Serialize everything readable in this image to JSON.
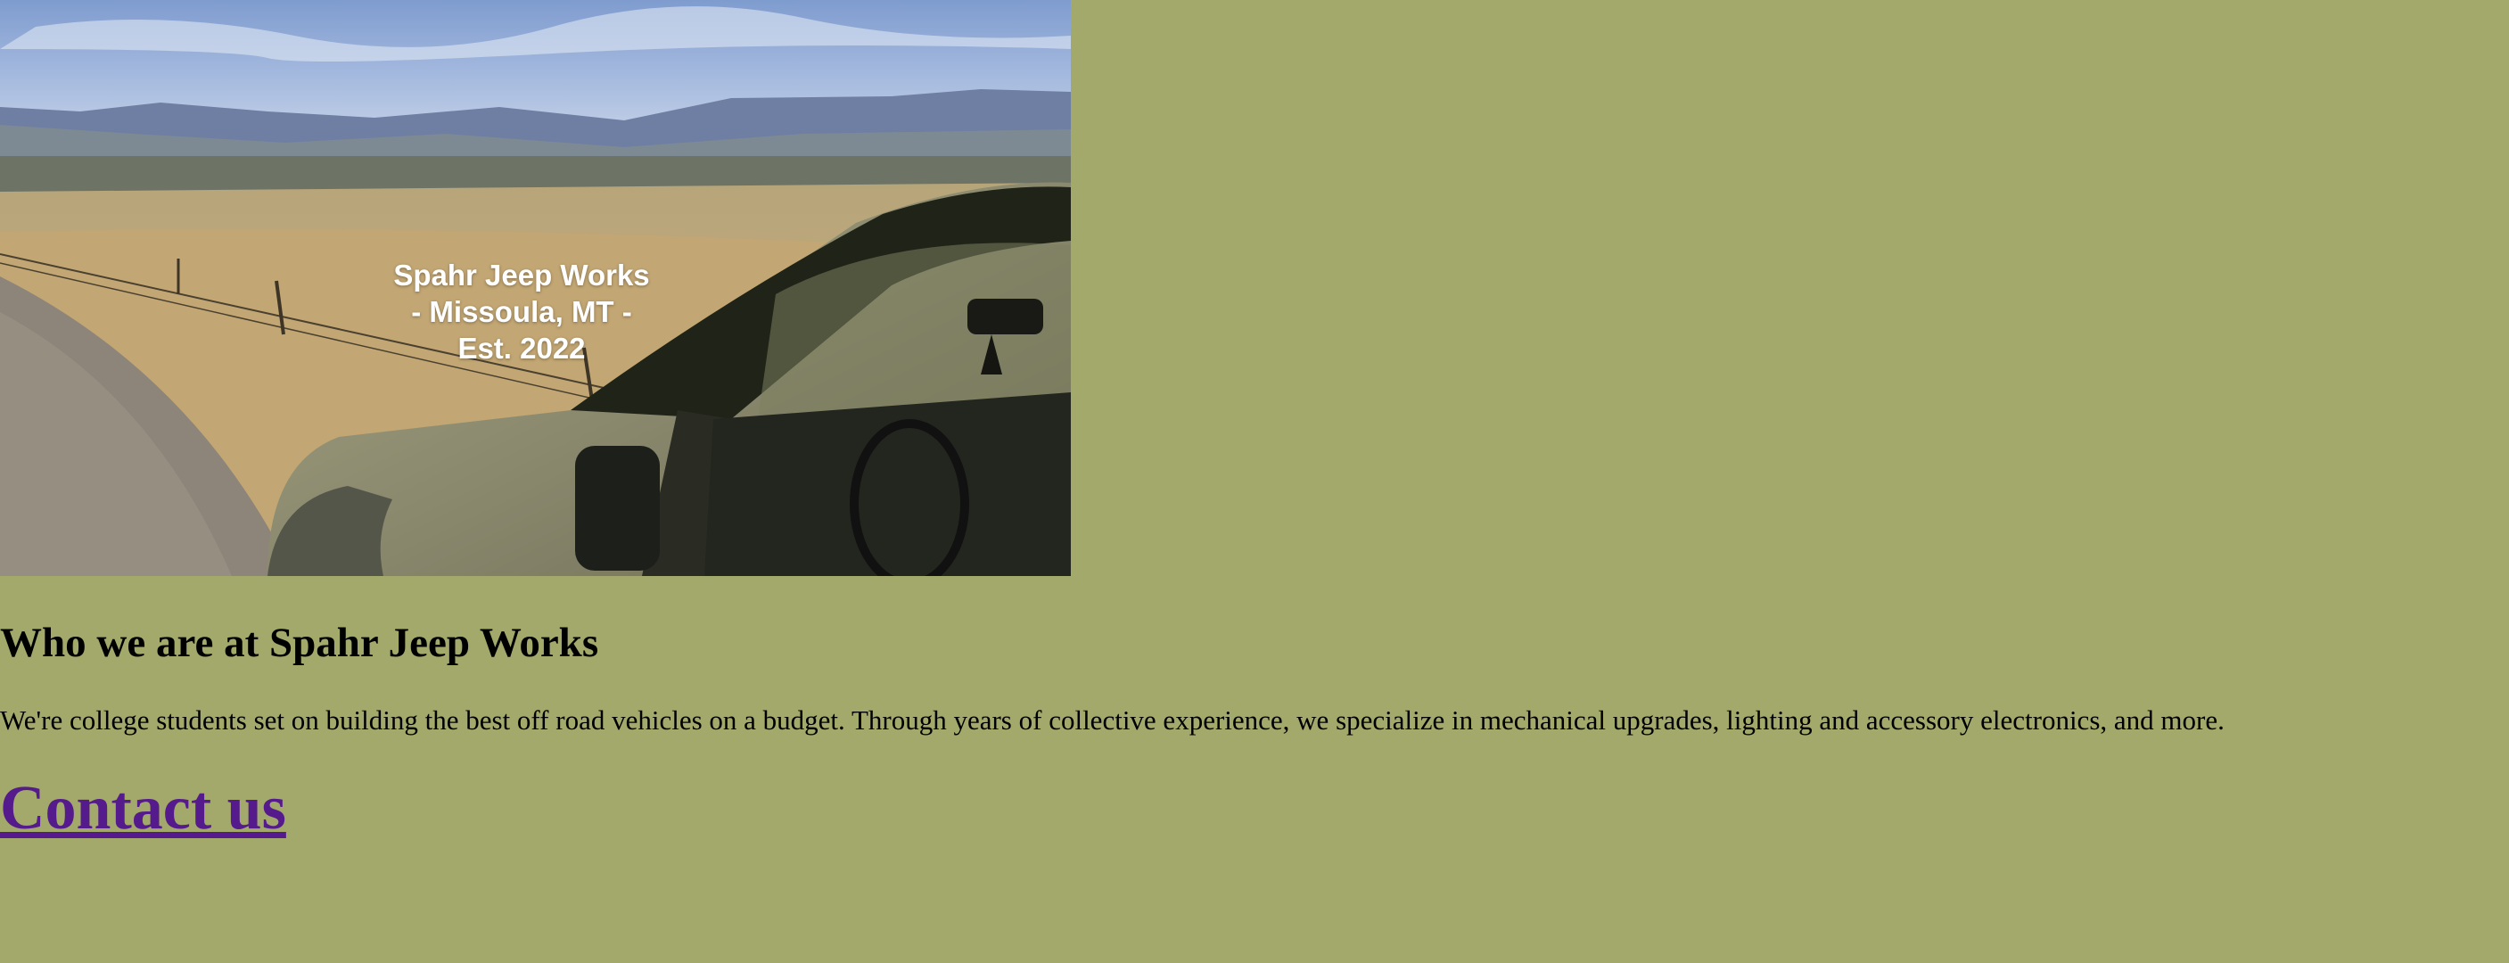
{
  "hero": {
    "caption_lines": [
      "Spahr Jeep Works",
      "- Missoula, MT -",
      "Est. 2022"
    ]
  },
  "about": {
    "heading": "Who we are at Spahr Jeep Works",
    "body": "We're college students set on building the best off road vehicles on a budget. Through years of collective experience, we specialize in mechanical upgrades, lighting and accessory electronics, and more."
  },
  "contact": {
    "link_label": "Contact us"
  },
  "colors": {
    "page_background": "#a3a96a",
    "visited_link": "#551a8b",
    "caption_text": "#ffffff"
  }
}
